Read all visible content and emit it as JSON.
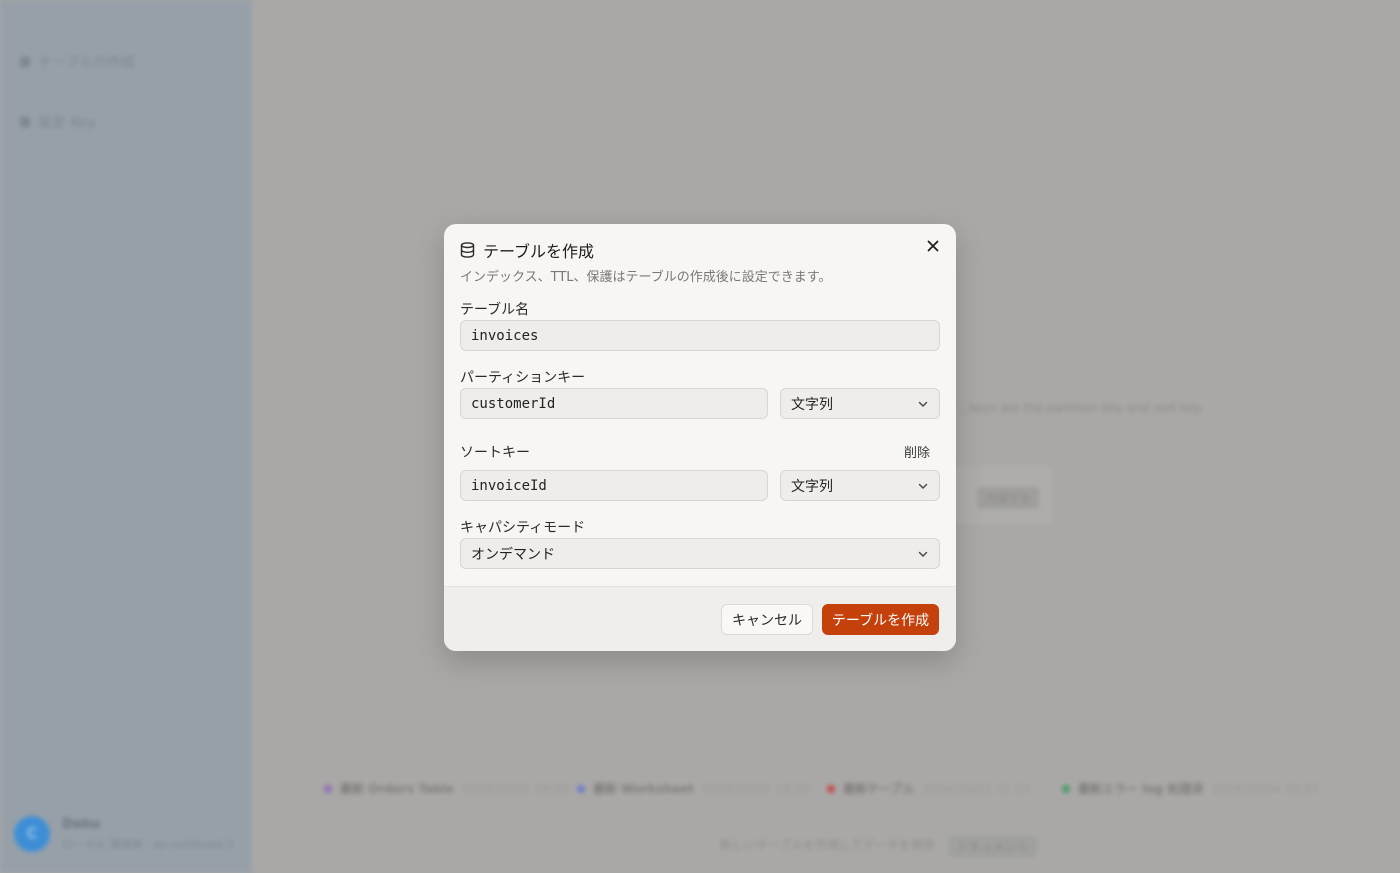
{
  "background": {
    "sidebar_items": [
      "テーブルの作成",
      "設定 Key"
    ],
    "user": {
      "avatar_initial": "C",
      "name": "Dabu",
      "subtitle": "ローカル 環境用 · ap-northeast-1"
    },
    "side_text": "... keys are the partition key and sort key.",
    "card_button": "作成する",
    "legend": [
      {
        "label": "最新 Orders Table",
        "value": "2024/10/01 09:00",
        "color": "#8f6fb6"
      },
      {
        "label": "最新 Worksheet",
        "value": "2024/10/02 14:30",
        "color": "#6d7cc4"
      },
      {
        "label": "最新テーブル",
        "value": "2024/10/03 11:15",
        "color": "#c24a4a"
      },
      {
        "label": "最新エラー log 処理済",
        "value": "2024/10/04 16:45",
        "color": "#4a9a6a"
      }
    ],
    "footer_text": "新しいテーブルを作成してデータを保存",
    "footer_chip": "ドキュメント"
  },
  "modal": {
    "title": "テーブルを作成",
    "description": "インデックス、TTL、保護はテーブルの作成後に設定できます。",
    "table_name": {
      "label": "テーブル名",
      "value": "invoices"
    },
    "partition_key": {
      "label": "パーティションキー",
      "value": "customerId",
      "type": "文字列"
    },
    "sort_key": {
      "label": "ソートキー",
      "value": "invoiceId",
      "type": "文字列",
      "remove_label": "削除"
    },
    "capacity_mode": {
      "label": "キャパシティモード",
      "value": "オンデマンド"
    },
    "cancel_label": "キャンセル",
    "create_label": "テーブルを作成"
  },
  "colors": {
    "accent": "#c5410c",
    "modal_bg": "#f7f6f4",
    "overlay": "#a8a7a4"
  },
  "icons": {
    "title": "database-icon",
    "close": "close-icon",
    "dropdown": "chevron-down-icon"
  }
}
